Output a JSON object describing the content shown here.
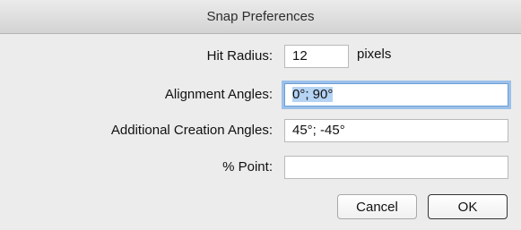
{
  "window": {
    "title": "Snap Preferences"
  },
  "fields": {
    "hit_radius": {
      "label": "Hit Radius:",
      "value": "12",
      "units": "pixels"
    },
    "alignment_angles": {
      "label": "Alignment Angles:",
      "value": "0°; 90°"
    },
    "additional_creation_angles": {
      "label": "Additional Creation Angles:",
      "value": "45°; -45°"
    },
    "percent_point": {
      "label": "% Point:",
      "value": ""
    }
  },
  "buttons": {
    "cancel": "Cancel",
    "ok": "OK"
  },
  "colors": {
    "focus_ring": "#9cc0ea",
    "selection": "#b5d3f3",
    "window_bg": "#ececec"
  }
}
